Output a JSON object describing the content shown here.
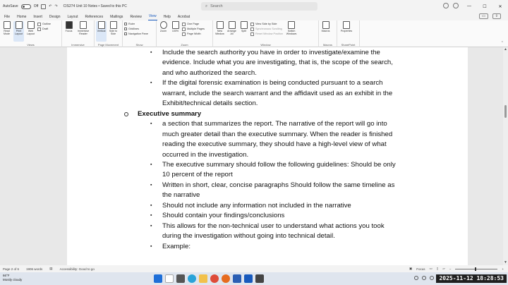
{
  "titlebar": {
    "autosave_label": "AutoSave",
    "autosave_state": "Off",
    "doc_title": "CIS274 Unit 10 Notes • Saved to this PC",
    "search_placeholder": "Search",
    "controls": {
      "minimize": "—",
      "maximize": "☐",
      "close": "✕"
    }
  },
  "menu": [
    "File",
    "Home",
    "Insert",
    "Design",
    "Layout",
    "References",
    "Mailings",
    "Review",
    "View",
    "Help",
    "Acrobat"
  ],
  "menu_active_index": 8,
  "ribbon": {
    "views": {
      "group": "Views",
      "read_mode": "Read Mode",
      "print_layout": "Print Layout",
      "web_layout": "Web Layout",
      "outline": "Outline",
      "draft": "Draft"
    },
    "immersive": {
      "group": "Immersive",
      "focus": "Focus",
      "immersive_reader": "Immersive Reader"
    },
    "page_movement": {
      "group": "Page Movement",
      "vertical": "Vertical",
      "side_to_side": "Side to Side"
    },
    "show": {
      "group": "Show",
      "ruler": "Ruler",
      "gridlines": "Gridlines",
      "navigation_pane": "Navigation Pane"
    },
    "zoom": {
      "group": "Zoom",
      "zoom": "Zoom",
      "hundred": "100%",
      "one_page": "One Page",
      "multiple_pages": "Multiple Pages",
      "page_width": "Page Width"
    },
    "window": {
      "group": "Window",
      "new_window": "New Window",
      "arrange_all": "Arrange All",
      "split": "Split",
      "view_side_by_side": "View Side by Side",
      "sync_scrolling": "Synchronous Scrolling",
      "reset_window": "Reset Window Position",
      "switch_windows": "Switch Windows"
    },
    "macros": {
      "group": "Macros",
      "macros": "Macros"
    },
    "sharepoint": {
      "group": "SharePoint",
      "properties": "Properties"
    }
  },
  "document": {
    "lines": [
      {
        "kind": "bullet",
        "text": "Include the search authority you have in order to investigate/examine the"
      },
      {
        "kind": "cont",
        "text": "evidence. Include what you are investigating, that is, the scope of the search,"
      },
      {
        "kind": "cont",
        "text": "and who authorized the search."
      },
      {
        "kind": "bullet",
        "text": "If the digital forensic examination is being conducted pursuant to a search"
      },
      {
        "kind": "cont",
        "text": "warrant, include the search warrant and the affidavit used as an exhibit in the"
      },
      {
        "kind": "cont",
        "text": "Exhibit/technical details section."
      },
      {
        "kind": "heading",
        "text": "Executive summary"
      },
      {
        "kind": "bullet",
        "text": "a section that summarizes the report. The narrative of the report will go into"
      },
      {
        "kind": "cont",
        "text": "much greater detail than the executive summary. When the reader is finished"
      },
      {
        "kind": "cont",
        "text": "reading the executive summary, they should have a high-level view of what"
      },
      {
        "kind": "cont",
        "text": "occurred in the investigation."
      },
      {
        "kind": "bullet",
        "text": "The executive summary should follow the following guidelines: Should be only"
      },
      {
        "kind": "cont",
        "text": "10 percent of the report"
      },
      {
        "kind": "bullet",
        "text": "Written in short, clear, concise paragraphs Should follow the same timeline as"
      },
      {
        "kind": "cont",
        "text": "the narrative"
      },
      {
        "kind": "bullet",
        "text": "Should not include any information not included in the narrative"
      },
      {
        "kind": "bullet",
        "text": "Should contain your findings/conclusions"
      },
      {
        "kind": "bullet",
        "text": "This allows for the non-technical user to understand what actions you took"
      },
      {
        "kind": "cont",
        "text": "during the investigation without going into technical detail."
      },
      {
        "kind": "bullet",
        "text": "Example:"
      }
    ]
  },
  "statusbar": {
    "page": "Page 2 of 6",
    "words": "1906 words",
    "accessibility": "Accessibility: Good to go",
    "focus": "Focus"
  },
  "taskbar": {
    "temperature": "66°F",
    "weather": "Mostly cloudy",
    "clock": "2025-11-12 18:28:53"
  },
  "colors": {
    "accent": "#185abd",
    "page": "#ffffff",
    "chrome": "#f3f3f3"
  }
}
